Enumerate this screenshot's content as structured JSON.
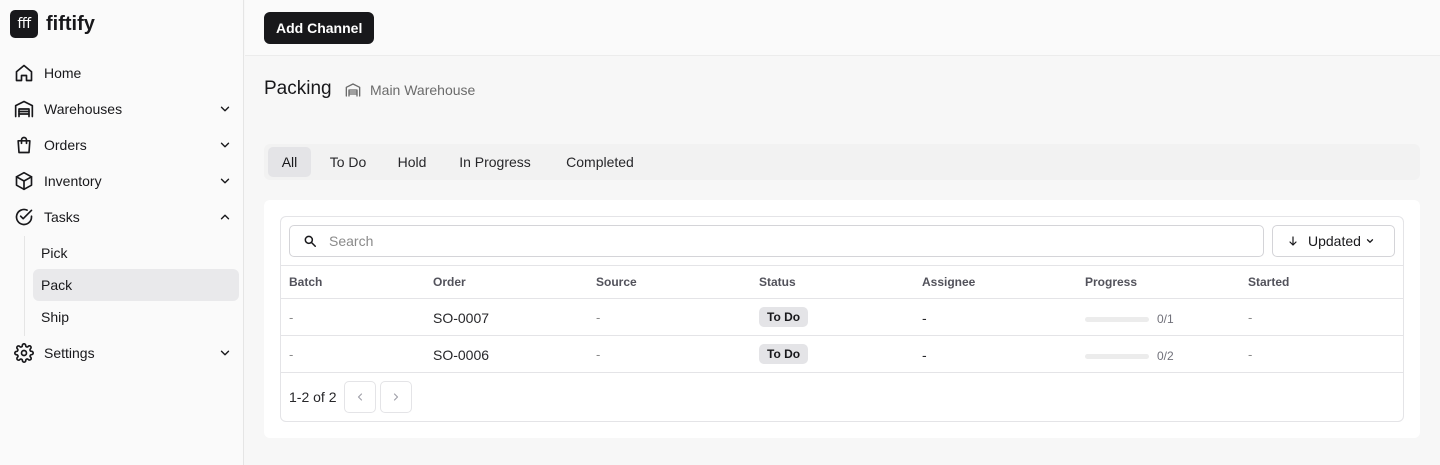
{
  "brand": {
    "logo_text": "fff",
    "name": "fiftify"
  },
  "sidebar": {
    "items": [
      {
        "label": "Home",
        "icon": "home-icon"
      },
      {
        "label": "Warehouses",
        "icon": "warehouse-icon"
      },
      {
        "label": "Orders",
        "icon": "shopping-bag-icon"
      },
      {
        "label": "Inventory",
        "icon": "box-icon"
      },
      {
        "label": "Tasks",
        "icon": "check-circle-icon"
      },
      {
        "label": "Settings",
        "icon": "gear-icon"
      }
    ],
    "tasks_sub": [
      "Pick",
      "Pack",
      "Ship"
    ],
    "active_sub": "Pack"
  },
  "topbar": {
    "add_channel_label": "Add Channel"
  },
  "page": {
    "title": "Packing",
    "warehouse": "Main Warehouse"
  },
  "tabs": [
    "All",
    "To Do",
    "Hold",
    "In Progress",
    "Completed"
  ],
  "active_tab": "All",
  "search": {
    "placeholder": "Search",
    "value": ""
  },
  "sort": {
    "label": "Updated"
  },
  "table": {
    "columns": [
      "Batch",
      "Order",
      "Source",
      "Status",
      "Assignee",
      "Progress",
      "Started"
    ],
    "rows": [
      {
        "batch": "-",
        "order": "SO-0007",
        "source": "-",
        "status": "To Do",
        "assignee": "-",
        "progress": "0/1",
        "progress_fraction": 0,
        "started": "-"
      },
      {
        "batch": "-",
        "order": "SO-0006",
        "source": "-",
        "status": "To Do",
        "assignee": "-",
        "progress": "0/2",
        "progress_fraction": 0,
        "started": "-"
      }
    ]
  },
  "pagination": {
    "summary": "1-2 of 2"
  },
  "colors": {
    "primary": "#18181b",
    "badge_bg": "#e4e4e7",
    "border": "#e4e4e7"
  }
}
